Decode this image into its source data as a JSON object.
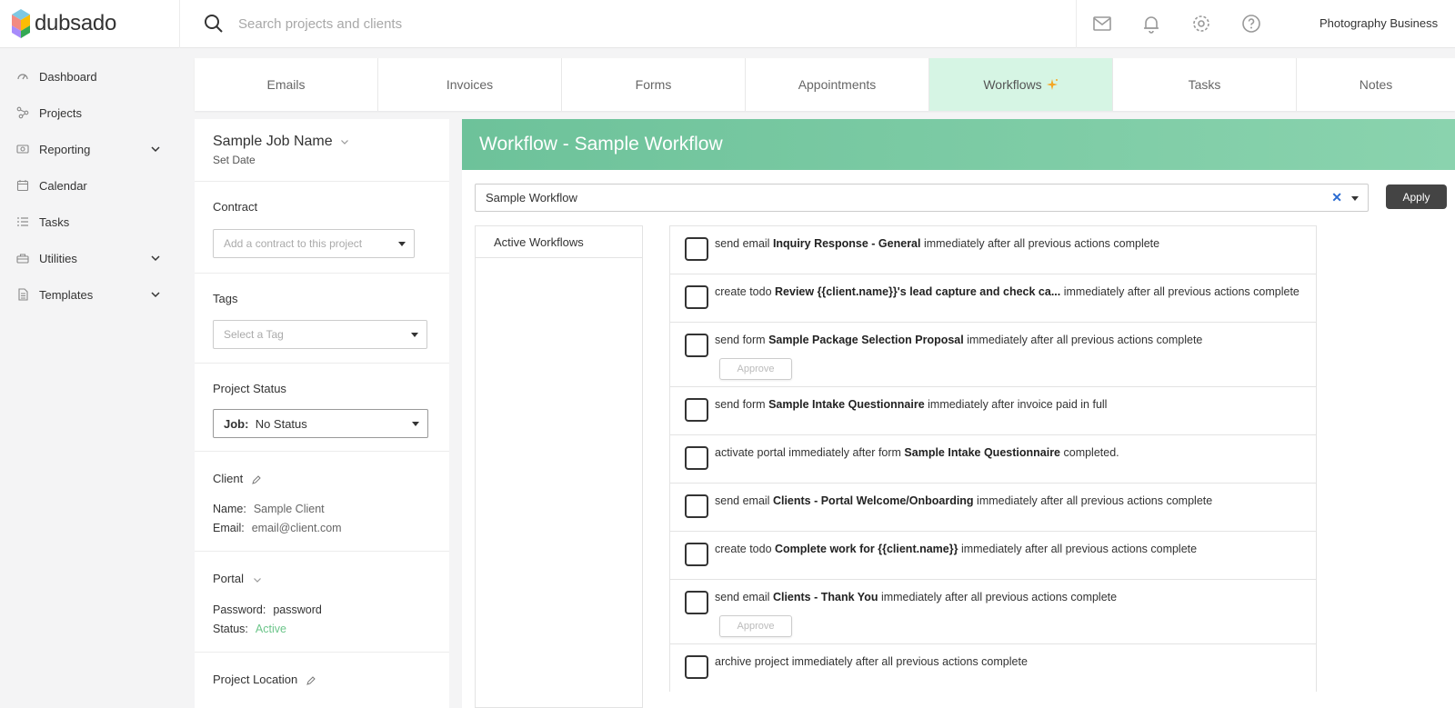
{
  "app": {
    "name": "dubsado"
  },
  "search": {
    "placeholder": "Search projects and clients"
  },
  "header": {
    "business_name": "Photography Business"
  },
  "sidebar": {
    "items": [
      {
        "label": "Dashboard",
        "icon": "dashboard-icon"
      },
      {
        "label": "Projects",
        "icon": "projects-icon"
      },
      {
        "label": "Reporting",
        "icon": "reporting-icon",
        "expandable": true
      },
      {
        "label": "Calendar",
        "icon": "calendar-icon"
      },
      {
        "label": "Tasks",
        "icon": "tasks-icon"
      },
      {
        "label": "Utilities",
        "icon": "utilities-icon",
        "expandable": true
      },
      {
        "label": "Templates",
        "icon": "templates-icon",
        "expandable": true
      }
    ]
  },
  "tabs": [
    {
      "label": "Emails"
    },
    {
      "label": "Invoices"
    },
    {
      "label": "Forms"
    },
    {
      "label": "Appointments"
    },
    {
      "label": "Workflows",
      "active": true
    },
    {
      "label": "Tasks"
    },
    {
      "label": "Notes"
    }
  ],
  "project": {
    "job_name": "Sample Job Name",
    "set_date": "Set Date",
    "contract": {
      "label": "Contract",
      "placeholder": "Add a contract to this project"
    },
    "tags": {
      "label": "Tags",
      "placeholder": "Select a Tag"
    },
    "status": {
      "label": "Project Status",
      "prefix": "Job:",
      "value": "No Status"
    },
    "client": {
      "label": "Client",
      "name_label": "Name:",
      "name": "Sample Client",
      "email_label": "Email:",
      "email": "email@client.com"
    },
    "portal": {
      "label": "Portal",
      "password_label": "Password:",
      "password": "password",
      "status_label": "Status:",
      "status": "Active"
    },
    "location": {
      "label": "Project Location"
    }
  },
  "workflow": {
    "title": "Workflow - Sample Workflow",
    "selected": "Sample Workflow",
    "apply_label": "Apply",
    "active_workflows_label": "Active Workflows",
    "approve_label": "Approve",
    "steps": [
      {
        "pre": "send email ",
        "bold": "Inquiry Response - General",
        "post": " immediately after all previous actions complete",
        "approve": false
      },
      {
        "pre": "create todo ",
        "bold": "Review {{client.name}}'s lead capture and check ca...",
        "post": " immediately after all previous actions complete",
        "approve": false
      },
      {
        "pre": "send form ",
        "bold": "Sample Package Selection Proposal",
        "post": " immediately after all previous actions complete",
        "approve": true
      },
      {
        "pre": "send form ",
        "bold": "Sample Intake Questionnaire",
        "post": " immediately after invoice paid in full",
        "approve": false
      },
      {
        "pre": "activate portal immediately after form ",
        "bold": "Sample Intake Questionnaire",
        "post": " completed.",
        "approve": false
      },
      {
        "pre": "send email ",
        "bold": "Clients - Portal Welcome/Onboarding",
        "post": " immediately after all previous actions complete",
        "approve": false
      },
      {
        "pre": "create todo ",
        "bold": "Complete work for {{client.name}}",
        "post": " immediately after all previous actions complete",
        "approve": false
      },
      {
        "pre": "send email ",
        "bold": "Clients - Thank You",
        "post": " immediately after all previous actions complete",
        "approve": true
      },
      {
        "pre": "archive project immediately after all previous actions complete",
        "bold": "",
        "post": "",
        "approve": false
      }
    ]
  },
  "colors": {
    "accent_green": "#6dc29a",
    "active_tab": "#d6f5e4",
    "status_active": "#6cc58a",
    "apply_button": "#444444"
  }
}
